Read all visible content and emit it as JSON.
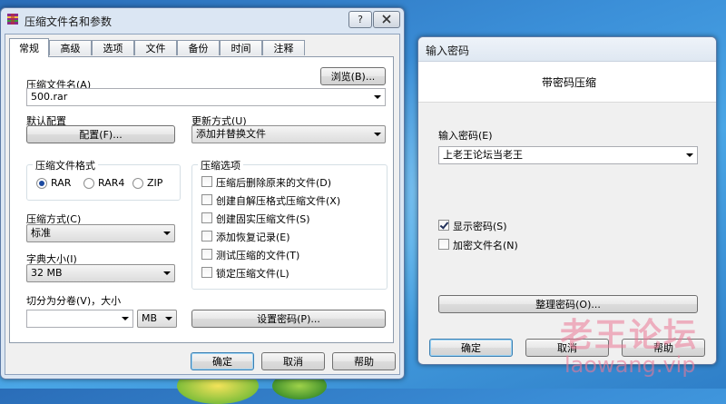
{
  "window_main": {
    "title": "压缩文件名和参数",
    "help_btn": "?",
    "tabs": [
      "常规",
      "高级",
      "选项",
      "文件",
      "备份",
      "时间",
      "注释"
    ],
    "archive_name_label": "压缩文件名(A)",
    "browse_btn": "浏览(B)...",
    "archive_name_value": "500.rar",
    "default_profile_label": "默认配置",
    "profiles_btn": "配置(F)...",
    "update_mode_label": "更新方式(U)",
    "update_mode_value": "添加并替换文件",
    "format_group_label": "压缩文件格式",
    "formats": [
      {
        "label": "RAR",
        "selected": true
      },
      {
        "label": "RAR4",
        "selected": false
      },
      {
        "label": "ZIP",
        "selected": false
      }
    ],
    "options_group_label": "压缩选项",
    "options": [
      {
        "label": "压缩后删除原来的文件(D)",
        "checked": false
      },
      {
        "label": "创建自解压格式压缩文件(X)",
        "checked": false
      },
      {
        "label": "创建固实压缩文件(S)",
        "checked": false
      },
      {
        "label": "添加恢复记录(E)",
        "checked": false
      },
      {
        "label": "测试压缩的文件(T)",
        "checked": false
      },
      {
        "label": "锁定压缩文件(L)",
        "checked": false
      }
    ],
    "method_label": "压缩方式(C)",
    "method_value": "标准",
    "dict_label": "字典大小(I)",
    "dict_value": "32 MB",
    "split_label": "切分为分卷(V)，大小",
    "split_value": "",
    "split_unit": "MB",
    "set_password_btn": "设置密码(P)...",
    "ok_btn": "确定",
    "cancel_btn": "取消",
    "help_btn_bottom": "帮助"
  },
  "window_password": {
    "title": "输入密码",
    "heading": "带密码压缩",
    "password_label": "输入密码(E)",
    "password_value": "上老王论坛当老王",
    "show_password_label": "显示密码(S)",
    "show_password_checked": true,
    "encrypt_names_label": "加密文件名(N)",
    "encrypt_names_checked": false,
    "organize_btn": "整理密码(O)...",
    "ok_btn": "确定",
    "cancel_btn": "取消",
    "help_btn": "帮助"
  },
  "watermark": {
    "line1": "老王论坛",
    "line2": "laowang.vip"
  }
}
